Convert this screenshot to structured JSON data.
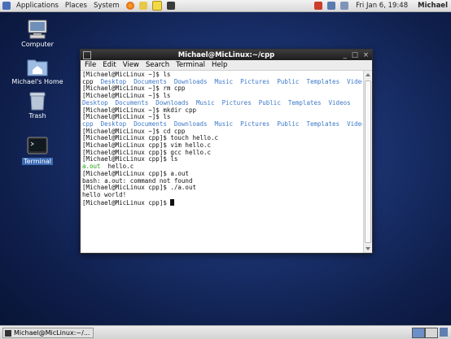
{
  "top_panel": {
    "menus": [
      "Applications",
      "Places",
      "System"
    ],
    "clock": "Fri Jan  6, 19:48",
    "user": "Michael"
  },
  "desktop": {
    "icons": [
      {
        "label": "Computer"
      },
      {
        "label": "Michael's Home"
      },
      {
        "label": "Trash"
      },
      {
        "label": "Terminal"
      }
    ]
  },
  "terminal": {
    "title": "Michael@MicLinux:~/cpp",
    "controls": {
      "minimize": "_",
      "maximize": "□",
      "close": "×"
    },
    "menu": [
      "File",
      "Edit",
      "View",
      "Search",
      "Terminal",
      "Help"
    ],
    "lines": [
      {
        "text": "[Michael@MicLinux ~]$ ls"
      },
      {
        "text": "cpp  ",
        "dirs": "Desktop  Documents  Downloads  Music  Pictures  Public  Templates  Videos"
      },
      {
        "text": "[Michael@MicLinux ~]$ rm cpp"
      },
      {
        "text": "[Michael@MicLinux ~]$ ls"
      },
      {
        "text": "",
        "dirs": "Desktop  Documents  Downloads  Music  Pictures  Public  Templates  Videos"
      },
      {
        "text": "[Michael@MicLinux ~]$ mkdir cpp"
      },
      {
        "text": "[Michael@MicLinux ~]$ ls"
      },
      {
        "text": "",
        "dirs": "cpp  Desktop  Documents  Downloads  Music  Pictures  Public  Templates  Videos"
      },
      {
        "text": "[Michael@MicLinux ~]$ cd cpp"
      },
      {
        "text": "[Michael@MicLinux cpp]$ touch hello.c"
      },
      {
        "text": "[Michael@MicLinux cpp]$ vim hello.c"
      },
      {
        "text": "[Michael@MicLinux cpp]$ gcc hello.c"
      },
      {
        "text": "[Michael@MicLinux cpp]$ ls"
      },
      {
        "exe": "a.out",
        "text": "  hello.c"
      },
      {
        "text": "[Michael@MicLinux cpp]$ a.out"
      },
      {
        "text": "bash: a.out: command not found"
      },
      {
        "text": "[Michael@MicLinux cpp]$ ./a.out"
      },
      {
        "text": "hello world!"
      },
      {
        "text": "[Michael@MicLinux cpp]$ ",
        "cursor": true
      }
    ]
  },
  "taskbar": {
    "window_button": "Michael@MicLinux:~/..."
  }
}
